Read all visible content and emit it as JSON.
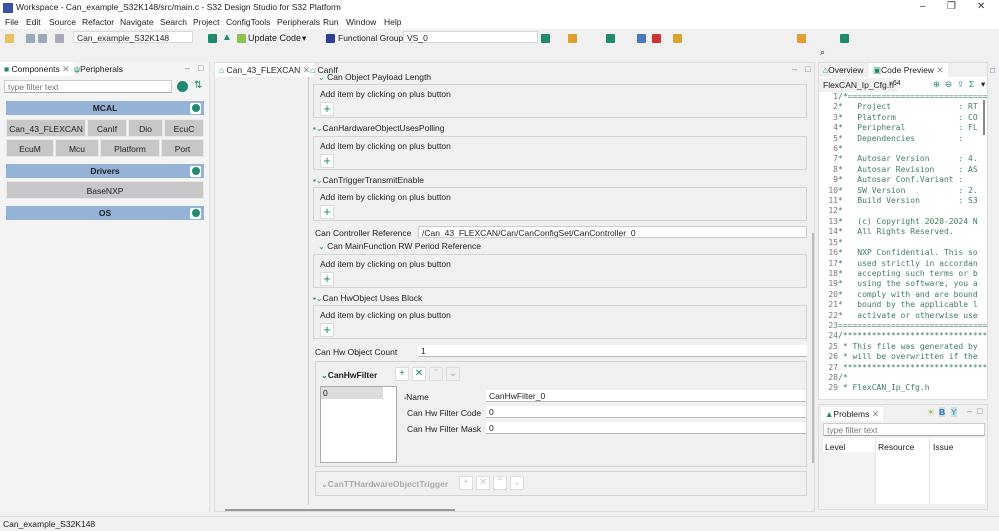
{
  "window": {
    "title": "Workspace - Can_example_S32K148/src/main.c - S32 Design Studio for S32 Platform",
    "minimize": "–",
    "maximize": "❐",
    "close": "✕"
  },
  "menu": [
    "File",
    "Edit",
    "Source",
    "Refactor",
    "Navigate",
    "Search",
    "Project",
    "ConfigTools",
    "Peripherals",
    "Run",
    "Window",
    "Help"
  ],
  "toolbar": {
    "project": "Can_example_S32K148",
    "update_code": "Update Code",
    "functional_group_label": "Functional Group",
    "functional_group": "VS_0"
  },
  "left": {
    "tabs": [
      "Components",
      "Peripherals"
    ],
    "filter_placeholder": "type filter text",
    "groups": [
      {
        "name": "MCAL",
        "rows": [
          [
            "Can_43_FLEXCAN",
            "CanIf",
            "Dio",
            "EcuC"
          ],
          [
            "EcuM",
            "Mcu",
            "Platform",
            "Port"
          ]
        ]
      },
      {
        "name": "Drivers",
        "rows": [
          [
            "BaseNXP"
          ]
        ]
      },
      {
        "name": "OS",
        "rows": []
      }
    ]
  },
  "editor": {
    "tabs": [
      "Can_43_FLEXCAN",
      "CanIf"
    ],
    "add_hint": "Add item by clicking on plus button",
    "sections": [
      "Can Object Payload Length",
      "CanHardwareObjectUsesPolling",
      "CanTriggerTransmitEnable",
      "Can MainFunction RW Period Reference",
      "Can HwObject Uses Block"
    ],
    "controller_ref_label": "Can Controller Reference",
    "controller_ref_value": "/Can_43_FLEXCAN/Can/CanConfigSet/CanController_0",
    "hw_obj_count_label": "Can Hw Object Count",
    "hw_obj_count_value": "1",
    "hwfilter": {
      "title": "CanHwFilter",
      "list": [
        "0"
      ],
      "name_label": "Name",
      "name_value": "CanHwFilter_0",
      "code_label": "Can Hw Filter Code",
      "code_value": "0",
      "mask_label": "Can Hw Filter Mask",
      "mask_value": "0"
    },
    "tt_trigger": "CanTTHardwareObjectTrigger"
  },
  "right": {
    "tabs": [
      "Overview",
      "Code Preview"
    ],
    "file_tab": "FlexCAN_Ip_Cfg.h",
    "more_tabs": "»64",
    "code": [
      "/*==================================",
      "*   Project              : RT",
      "*   Platform             : CO",
      "*   Peripheral           : FL",
      "*   Dependencies         :",
      "*",
      "*   Autosar Version      : 4.",
      "*   Autosar Revision     : AS",
      "*   Autosar Conf.Variant :",
      "*   SW Version           : 2.",
      "*   Build Version        : S3",
      "*",
      "*   (c) Copyright 2020-2024 N",
      "*   All Rights Reserved.",
      "*",
      "*   NXP Confidential. This so",
      "*   used strictly in accordan",
      "*   accepting such terms or b",
      "*   using the software, you a",
      "*   comply with and are bound",
      "*   bound by the applicable l",
      "*   activate or otherwise use",
      "==================================",
      "/*********************************",
      " * This file was generated by",
      " * will be overwritten if the",
      " *********************************",
      "/*",
      " * FlexCAN_Ip_Cfg.h"
    ]
  },
  "problems": {
    "tab": "Problems",
    "filter_placeholder": "type filter text",
    "columns": [
      "Level",
      "Resource",
      "Issue"
    ]
  },
  "status": "Can_example_S32K148"
}
